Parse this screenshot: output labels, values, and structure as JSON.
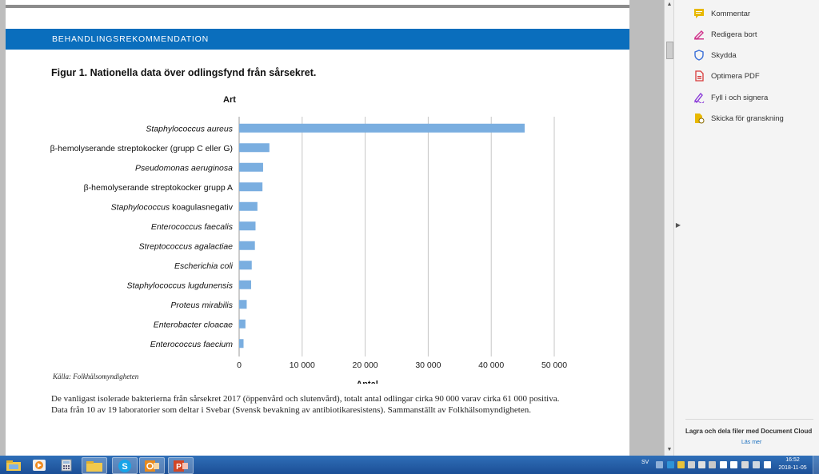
{
  "document": {
    "section_label": "BEHANDLINGSREKOMMENDATION",
    "figure_title": "Figur 1. Nationella data över odlingsfynd från sårsekret.",
    "source": "Källa: Folkhälsomyndigheten",
    "caption_lines": [
      "De vanligast isolerade bakterierna från sårsekret 2017 (öppenvård och slutenvård), totalt antal odlingar cirka 90 000 varav cirka 61 000 positiva.",
      "Data från 10 av 19 laboratorier som deltar i Svebar (Svensk bevakning av antibiotikaresistens). Sammanställt av Folkhälsomyndigheten."
    ]
  },
  "chart_data": {
    "type": "bar",
    "orientation": "horizontal",
    "ylabel": "Art",
    "xlabel": "Antal",
    "xlim": [
      0,
      50000
    ],
    "xticks": [
      0,
      10000,
      20000,
      30000,
      40000,
      50000
    ],
    "xtick_labels": [
      "0",
      "10 000",
      "20 000",
      "30 000",
      "40 000",
      "50 000"
    ],
    "bar_color": "#7aaee0",
    "grid": "vertical",
    "categories": [
      [
        {
          "t": "Staphylococcus aureus",
          "i": true
        }
      ],
      [
        {
          "t": "β-hemolyserande streptokocker (grupp C eller G)",
          "i": false
        }
      ],
      [
        {
          "t": "Pseudomonas aeruginosa",
          "i": true
        }
      ],
      [
        {
          "t": "β-hemolyserande streptokocker grupp A",
          "i": false
        }
      ],
      [
        {
          "t": "Staphylococcus",
          "i": true
        },
        {
          "t": " koagulasnegativ",
          "i": false
        }
      ],
      [
        {
          "t": "Enterococcus faecalis",
          "i": true
        }
      ],
      [
        {
          "t": "Streptococcus agalactiae",
          "i": true
        }
      ],
      [
        {
          "t": "Escherichia coli",
          "i": true
        }
      ],
      [
        {
          "t": "Staphylococcus lugdunensis",
          "i": true
        }
      ],
      [
        {
          "t": "Proteus mirabilis",
          "i": true
        }
      ],
      [
        {
          "t": "Enterobacter cloacae",
          "i": true
        }
      ],
      [
        {
          "t": "Enterococcus faecium",
          "i": true
        }
      ]
    ],
    "values": [
      45300,
      4800,
      3800,
      3700,
      2900,
      2600,
      2500,
      2000,
      1900,
      1200,
      1000,
      700
    ]
  },
  "tools": [
    {
      "label": "Kommentar",
      "icon": "comment-icon",
      "color": "#e8b800"
    },
    {
      "label": "Redigera bort",
      "icon": "redact-icon",
      "color": "#d0308a"
    },
    {
      "label": "Skydda",
      "icon": "shield-icon",
      "color": "#3a6fd8"
    },
    {
      "label": "Optimera PDF",
      "icon": "optimize-pdf-icon",
      "color": "#d83a3a"
    },
    {
      "label": "Fyll i och signera",
      "icon": "sign-icon",
      "color": "#8a3ad8"
    },
    {
      "label": "Skicka för granskning",
      "icon": "send-review-icon",
      "color": "#e8b800"
    }
  ],
  "cloud": {
    "title": "Lagra och dela filer med Document Cloud",
    "link": "Läs mer"
  },
  "taskbar": {
    "apps": [
      "windows-explorer-icon",
      "media-player-icon",
      "calculator-icon",
      "folder-icon",
      "skype-icon",
      "outlook-icon",
      "powerpoint-icon"
    ],
    "language": "SV",
    "time": "16:52",
    "date": "2018-11-05"
  }
}
